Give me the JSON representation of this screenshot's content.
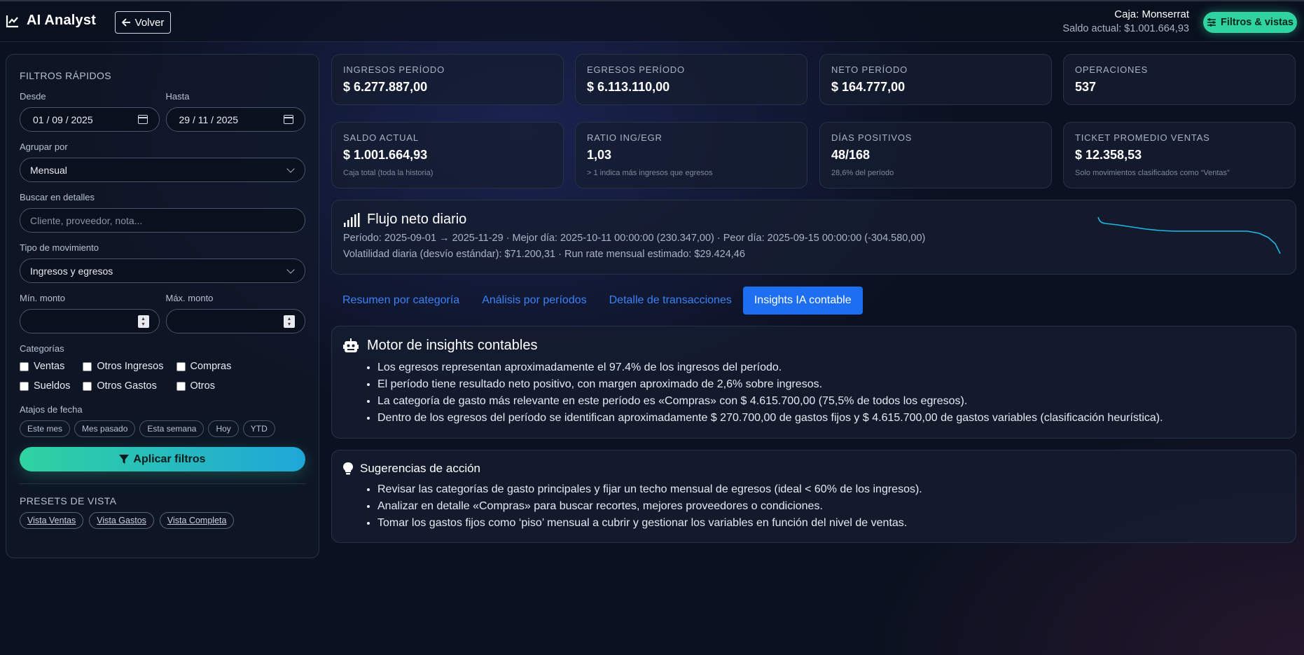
{
  "header": {
    "title": "AI Analyst",
    "back_label": "Volver",
    "caja_name": "Caja: Monserrat",
    "caja_saldo": "Saldo actual: $1.001.664,93",
    "filters_button": "Filtros & vistas"
  },
  "sidebar": {
    "title": "FILTROS RÁPIDOS",
    "desde_label": "Desde",
    "desde_value": "01 / 09 / 2025",
    "hasta_label": "Hasta",
    "hasta_value": "29 / 11 / 2025",
    "agrupar_label": "Agrupar por",
    "agrupar_value": "Mensual",
    "buscar_label": "Buscar en detalles",
    "buscar_placeholder": "Cliente, proveedor, nota...",
    "tipo_label": "Tipo de movimiento",
    "tipo_value": "Ingresos y egresos",
    "min_label": "Mín. monto",
    "max_label": "Máx. monto",
    "categorias_label": "Categorías",
    "categorias": [
      "Ventas",
      "Otros Ingresos",
      "Compras",
      "Sueldos",
      "Otros Gastos",
      "Otros"
    ],
    "atajos_label": "Atajos de fecha",
    "atajos": [
      "Este mes",
      "Mes pasado",
      "Esta semana",
      "Hoy",
      "YTD"
    ],
    "apply_label": "Aplicar filtros",
    "presets_label": "PRESETS DE VISTA",
    "presets": [
      "Vista Ventas",
      "Vista Gastos",
      "Vista Completa"
    ]
  },
  "kpis": [
    {
      "label": "INGRESOS PERÍODO",
      "value": "$ 6.277.887,00",
      "note": ""
    },
    {
      "label": "EGRESOS PERÍODO",
      "value": "$ 6.113.110,00",
      "note": ""
    },
    {
      "label": "NETO PERÍODO",
      "value": "$ 164.777,00",
      "note": ""
    },
    {
      "label": "OPERACIONES",
      "value": "537",
      "note": ""
    },
    {
      "label": "SALDO ACTUAL",
      "value": "$ 1.001.664,93",
      "note": "Caja total (toda la historia)"
    },
    {
      "label": "RATIO ING/EGR",
      "value": "1,03",
      "note": "> 1 indica más ingresos que egresos"
    },
    {
      "label": "DÍAS POSITIVOS",
      "value": "48/168",
      "note": "28,6% del período"
    },
    {
      "label": "TICKET PROMEDIO VENTAS",
      "value": "$ 12.358,53",
      "note": "Solo movimientos clasificados como “Ventas”"
    }
  ],
  "flujo": {
    "title": "Flujo neto diario",
    "line1": "Período: 2025-09-01 → 2025-11-29 · Mejor día: 2025-10-11 00:00:00 (230.347,00) · Peor día: 2025-09-15 00:00:00 (-304.580,00)",
    "line2": "Volatilidad diaria (desvío estándar): $71.200,31 · Run rate mensual estimado: $29.424,46",
    "spark_color": "#22b8e6"
  },
  "tabs": [
    "Resumen por categoría",
    "Análisis por períodos",
    "Detalle de transacciones",
    "Insights IA contable"
  ],
  "insights": {
    "title": "Motor de insights contables",
    "items": [
      "Los egresos representan aproximadamente el 97.4% de los ingresos del período.",
      "El período tiene resultado neto positivo, con margen aproximado de 2,6% sobre ingresos.",
      "La categoría de gasto más relevante en este período es «Compras» con $ 4.615.700,00 (75,5% de todos los egresos).",
      "Dentro de los egresos del período se identifican aproximadamente $ 270.700,00 de gastos fijos y $ 4.615.700,00 de gastos variables (clasificación heurística)."
    ]
  },
  "sugerencias": {
    "title": "Sugerencias de acción",
    "items": [
      "Revisar las categorías de gasto principales y fijar un techo mensual de egresos (ideal < 60% de los ingresos).",
      "Analizar en detalle «Compras» para buscar recortes, mejores proveedores o condiciones.",
      "Tomar los gastos fijos como ‘piso’ mensual a cubrir y gestionar los variables en función del nivel de ventas."
    ]
  },
  "colors": {
    "accent_green": "#2fd3a0",
    "accent_blue": "#1d6ef0",
    "link_blue": "#3b82f6"
  }
}
